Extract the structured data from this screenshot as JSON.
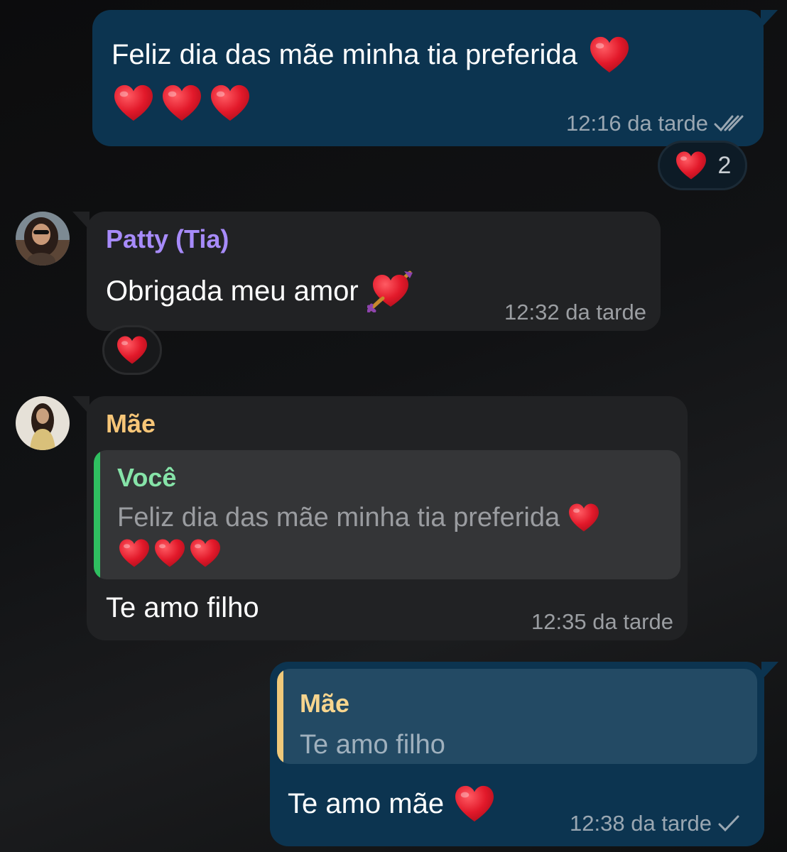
{
  "messages": [
    {
      "direction": "outgoing",
      "text_line1": "Feliz dia das mãe minha tia preferida",
      "time": "12:16 da tarde",
      "status": "read",
      "reaction": {
        "emoji": "heart-icon",
        "count": "2"
      }
    },
    {
      "direction": "incoming",
      "sender": "Patty (Tia)",
      "sender_color": "#a78bfa",
      "text": "Obrigada meu amor",
      "time": "12:32 da tarde",
      "reaction": {
        "emoji": "heart-icon"
      }
    },
    {
      "direction": "incoming",
      "sender": "Mãe",
      "sender_color": "#f7c678",
      "quote": {
        "name": "Você",
        "name_color": "#86e3a8",
        "text": "Feliz dia das mãe minha tia preferida"
      },
      "text": "Te amo filho",
      "time": "12:35 da tarde"
    },
    {
      "direction": "outgoing",
      "quote": {
        "name": "Mãe",
        "name_color": "#f7d58e",
        "text": "Te amo filho"
      },
      "text": "Te amo mãe",
      "time": "12:38 da tarde",
      "status": "sent"
    }
  ],
  "colors": {
    "outgoing_bubble": "#0c3450",
    "incoming_bubble": "#212224",
    "heart": "#e0202e"
  }
}
